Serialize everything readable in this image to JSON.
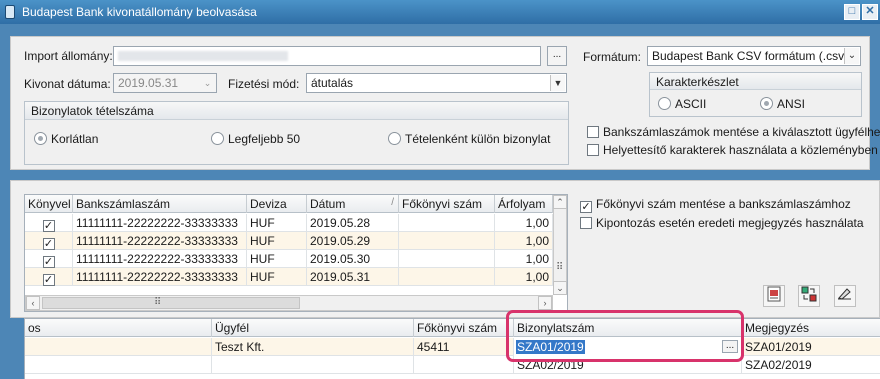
{
  "window": {
    "title": "Budapest Bank kivonatállomány beolvasása",
    "minimize": "□",
    "close": "✕"
  },
  "import": {
    "label": "Import állomány:",
    "value": "",
    "browse": "..."
  },
  "date": {
    "label": "Kivonat dátuma:",
    "value": "2019.05.31"
  },
  "payment": {
    "label": "Fizetési mód:",
    "value": "átutalás"
  },
  "format": {
    "label": "Formátum:",
    "value": "Budapest Bank CSV formátum (.csv)"
  },
  "charset": {
    "title": "Karakterkészlet",
    "ascii": "ASCII",
    "ansi": "ANSI"
  },
  "items": {
    "title": "Bizonylatok tételszáma",
    "unlimited": "Korlátlan",
    "max50": "Legfeljebb 50",
    "separate": "Tételenként külön bizonylat"
  },
  "options": {
    "save_accounts": "Bankszámlaszámok mentése a kiválasztott ügyfélhez",
    "replace_chars": "Helyettesítő karakterek használata a közleményben",
    "save_ledger": "Főkönyvi szám mentése a bankszámlaszámhoz",
    "kipontozas": "Kipontozás esetén eredeti megjegyzés használata"
  },
  "top_grid": {
    "headers": [
      "Könyvel",
      "Bankszámlaszám",
      "Deviza",
      "Dátum",
      "Főkönyvi szám",
      "Árfolyam"
    ],
    "sort_indicator": "/",
    "rows": [
      {
        "account": "11111111-22222222-33333333",
        "currency": "HUF",
        "date": "2019.05.28",
        "ledger": "",
        "rate": "1,00"
      },
      {
        "account": "11111111-22222222-33333333",
        "currency": "HUF",
        "date": "2019.05.29",
        "ledger": "",
        "rate": "1,00"
      },
      {
        "account": "11111111-22222222-33333333",
        "currency": "HUF",
        "date": "2019.05.30",
        "ledger": "",
        "rate": "1,00"
      },
      {
        "account": "11111111-22222222-33333333",
        "currency": "HUF",
        "date": "2019.05.31",
        "ledger": "",
        "rate": "1,00"
      }
    ],
    "grip": "⠿"
  },
  "bottom_grid": {
    "headers": [
      "os",
      "Ügyfél",
      "Főkönyvi szám",
      "Bizonylatszám",
      "Megjegyzés"
    ],
    "rows": [
      {
        "col0": "",
        "client": "Teszt Kft.",
        "ledger": "45411",
        "docno": "SZA01/2019",
        "note": "SZA01/2019"
      },
      {
        "col0": "",
        "client": "",
        "ledger": "",
        "docno": "SZA02/2019",
        "note": "SZA02/2019"
      }
    ],
    "cell_button": "..."
  },
  "colors": {
    "highlight": "#d8336b",
    "titlebar": "#2f6ea6"
  }
}
